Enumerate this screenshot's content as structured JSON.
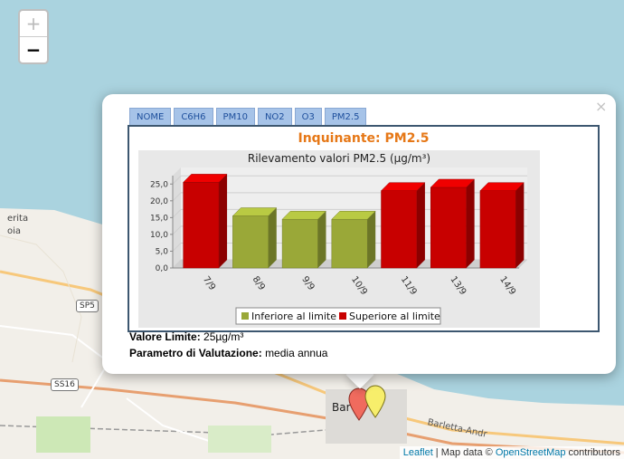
{
  "map": {
    "zoom_in_label": "+",
    "zoom_out_label": "−",
    "place_labels": [
      "erita",
      "oia",
      "Bar"
    ],
    "road_labels": [
      "SP5",
      "SS16",
      "Barletta-Andr"
    ],
    "attribution": {
      "leaflet": "Leaflet",
      "separator": " | Map data © ",
      "osm": "OpenStreetMap",
      "suffix": " contributors"
    }
  },
  "popup": {
    "close_label": "×",
    "tabs": [
      "NOME",
      "C6H6",
      "PM10",
      "NO2",
      "O3",
      "PM2.5"
    ],
    "heading": "Inquinante: PM2.5",
    "limit_label": "Valore Limite:",
    "limit_value": "25µg/m³",
    "param_label": "Parametro di Valutazione:",
    "param_value": "media annua"
  },
  "colors": {
    "below": "#9aa838",
    "above": "#c80000",
    "heading": "#e67817"
  },
  "chart_data": {
    "type": "bar",
    "title": "Rilevamento valori PM2.5 (µg/m³)",
    "categories": [
      "7/9",
      "8/9",
      "9/9",
      "10/9",
      "11/9",
      "13/9",
      "14/9"
    ],
    "values": [
      25.5,
      15.5,
      14.5,
      14.5,
      23.0,
      24.0,
      23.0
    ],
    "classes": [
      "above",
      "below",
      "below",
      "below",
      "above",
      "above",
      "above"
    ],
    "ylim": [
      0,
      27.5
    ],
    "yticks": [
      "0,0",
      "5,0",
      "10,0",
      "15,0",
      "20,0",
      "25,0"
    ],
    "legend": [
      {
        "key": "below",
        "label": "Inferiore al limite"
      },
      {
        "key": "above",
        "label": "Superiore al limite"
      }
    ],
    "legend_position": "bottom",
    "grid": true
  }
}
